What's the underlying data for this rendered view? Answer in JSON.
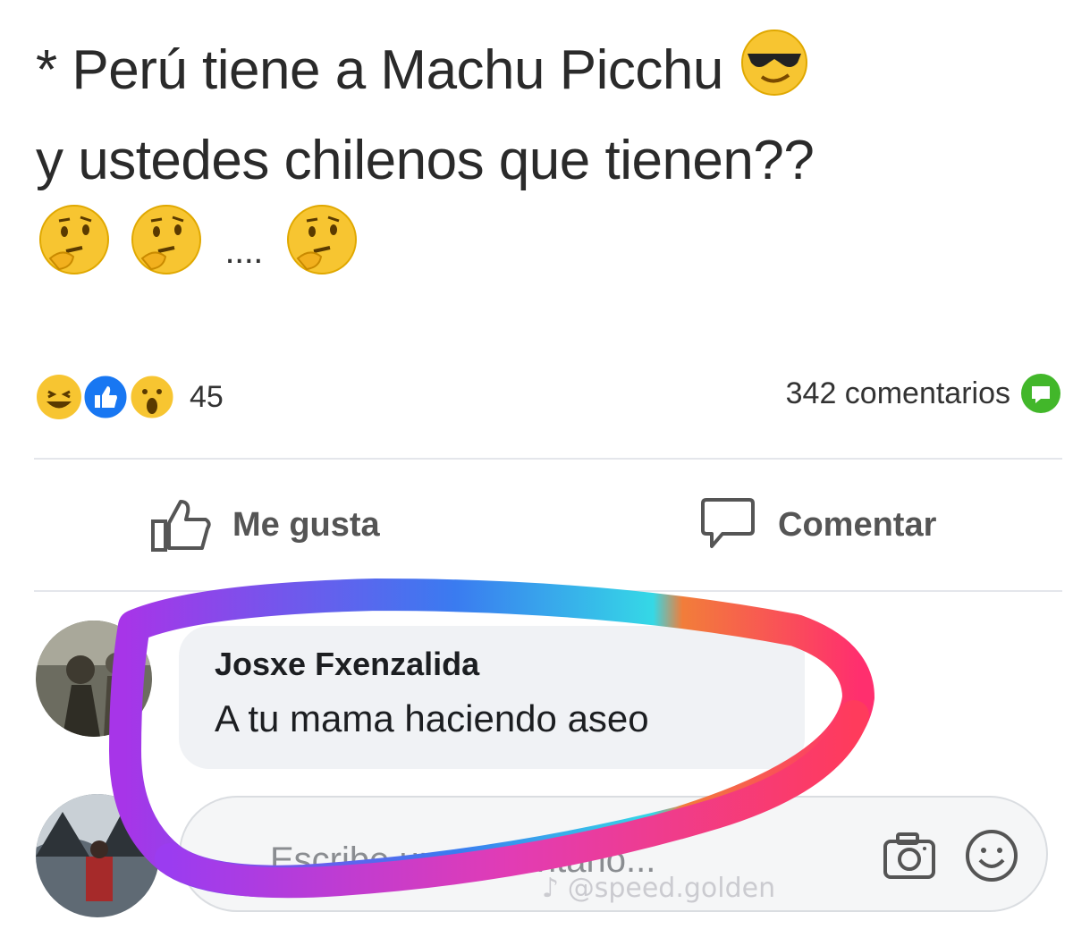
{
  "post": {
    "line1": "* Perú tiene a Machu Picchu",
    "line2": "y ustedes chilenos que tienen??",
    "line3_dots": "....",
    "emoji_line1": "sunglasses-face-icon",
    "emoji_line3": [
      "thinking-face-icon",
      "thinking-face-icon",
      "thinking-face-icon"
    ]
  },
  "stats": {
    "reactions": [
      "haha-icon",
      "like-icon",
      "wow-icon"
    ],
    "reaction_count": "45",
    "comment_count_label": "342 comentarios"
  },
  "actions": {
    "like_label": "Me gusta",
    "comment_label": "Comentar"
  },
  "comment": {
    "author": "Josxe Fxenzalida",
    "text": "A tu mama haciendo aseo"
  },
  "composer": {
    "placeholder": "Escribe un comentario..."
  },
  "watermark": "@speed.golden",
  "colors": {
    "scribble_start": "#9b3cf0",
    "scribble_mid": "#35d8e6",
    "scribble_end": "#ff3b6b",
    "like_blue": "#1877f2",
    "comment_green": "#42b72a"
  }
}
